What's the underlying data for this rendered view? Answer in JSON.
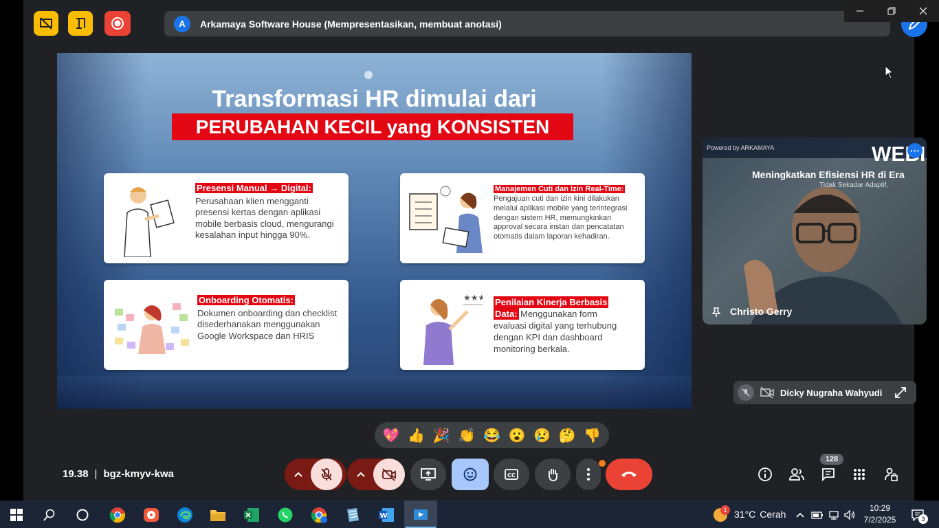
{
  "window": {
    "minimize_icon": "minimize-icon",
    "restore_icon": "restore-icon",
    "close_icon": "close-icon"
  },
  "top_bar": {
    "presenter_initial": "A",
    "presenter_text": "Arkamaya Software House (Mempresentasikan, membuat anotasi)"
  },
  "slide": {
    "title_line1": "Transformasi HR dimulai dari",
    "title_line2": "PERUBAHAN KECIL yang KONSISTEN",
    "cards": [
      {
        "heading": "Presensi Manual → Digital:",
        "body": "Perusahaan klien mengganti presensi kertas dengan aplikasi mobile berbasis cloud, mengurangi kesalahan input hingga 90%."
      },
      {
        "heading": "Manajemen Cuti dan Izin Real-Time:",
        "body": "Pengajuan cuti dan izin kini dilakukan melalui aplikasi mobile yang terintegrasi dengan sistem HR, memungkinkan approval secara instan dan pencatatan otomatis dalam laporan kehadiran."
      },
      {
        "heading": "Onboarding Otomatis:",
        "body": "Dokumen onboarding dan checklist disederhanakan menggunakan Google Workspace dan HRIS"
      },
      {
        "heading_line1": "Penilaian Kinerja Berbasis",
        "heading_line2": "Data:",
        "body_first": "Menggunakan form",
        "body_rest": "evaluasi digital yang terhubung dengan KPI dan dashboard monitoring berkala."
      }
    ]
  },
  "self_view": {
    "bg_powered": "Powered by ARKAMAYA",
    "bg_webi": "WEBI",
    "bg_line1": "Meningkatkan Efisiensi HR di Era",
    "bg_line2": "Tidak Sekadar Adaptif,",
    "name": "Christo Gerry"
  },
  "participant_tile": {
    "name": "Dicky Nugraha Wahyudi"
  },
  "reactions": [
    "💖",
    "👍",
    "🎉",
    "👏",
    "😂",
    "😮",
    "😢",
    "🤔",
    "👎"
  ],
  "meeting": {
    "time": "19.38",
    "separator": "|",
    "code": "bgz-kmyv-kwa"
  },
  "participants_count": "128",
  "taskbar": {
    "notification_count": "1",
    "temperature": "31°C",
    "condition": "Cerah",
    "time": "10:29",
    "date": "7/2/2025",
    "action_center_count": "3"
  },
  "colors": {
    "accent_blue": "#1a73e8",
    "end_call_red": "#ea4335",
    "yellow": "#fbbc04",
    "slide_red": "#e30613"
  }
}
